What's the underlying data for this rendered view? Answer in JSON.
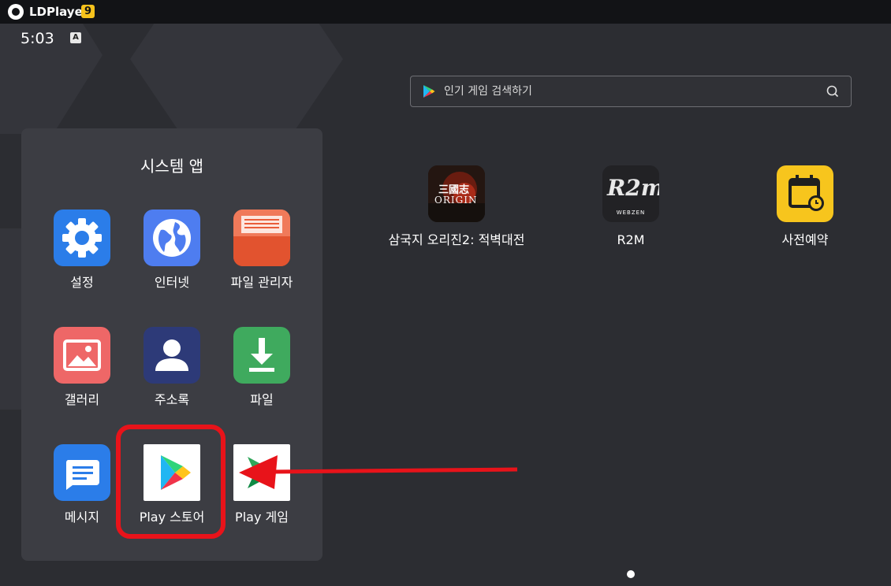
{
  "titlebar": {
    "app_name": "LDPlayer",
    "version": "9"
  },
  "statusbar": {
    "time": "5:03",
    "input_indicator": "A"
  },
  "search": {
    "placeholder": "인기 게임 검색하기",
    "icon": "search-icon"
  },
  "folder": {
    "title": "시스템 앱",
    "apps": [
      {
        "label": "설정",
        "icon": "gear-icon",
        "color": "#2b7de9"
      },
      {
        "label": "인터넷",
        "icon": "globe-icon",
        "color": "#4e7df0"
      },
      {
        "label": "파일 관리자",
        "icon": "folder-icon",
        "color": "#e95d3a"
      },
      {
        "label": "갤러리",
        "icon": "image-icon",
        "color": "#ee6767"
      },
      {
        "label": "주소록",
        "icon": "person-icon",
        "color": "#2d3a78"
      },
      {
        "label": "파일",
        "icon": "download-icon",
        "color": "#3faa5e"
      },
      {
        "label": "메시지",
        "icon": "message-icon",
        "color": "#2b7de9"
      },
      {
        "label": "Play 스토어",
        "icon": "play-store-icon",
        "color": "#ffffff"
      },
      {
        "label": "Play 게임",
        "icon": "play-games-icon",
        "color": "#ffffff"
      }
    ]
  },
  "desktop_apps": [
    {
      "label": "삼국지 오리진2: 적벽대전",
      "icon": "sanguozhi-origin2-icon",
      "icon_text": "三國志",
      "icon_subtext": "ORIGIN"
    },
    {
      "label": "R2M",
      "icon": "r2m-icon",
      "icon_text": "R2m",
      "icon_subtext": "WEBZEN"
    },
    {
      "label": "사전예약",
      "icon": "calendar-icon"
    }
  ],
  "annotation": {
    "highlight_color": "#e8131a"
  },
  "pager": {
    "active_page": 1
  }
}
